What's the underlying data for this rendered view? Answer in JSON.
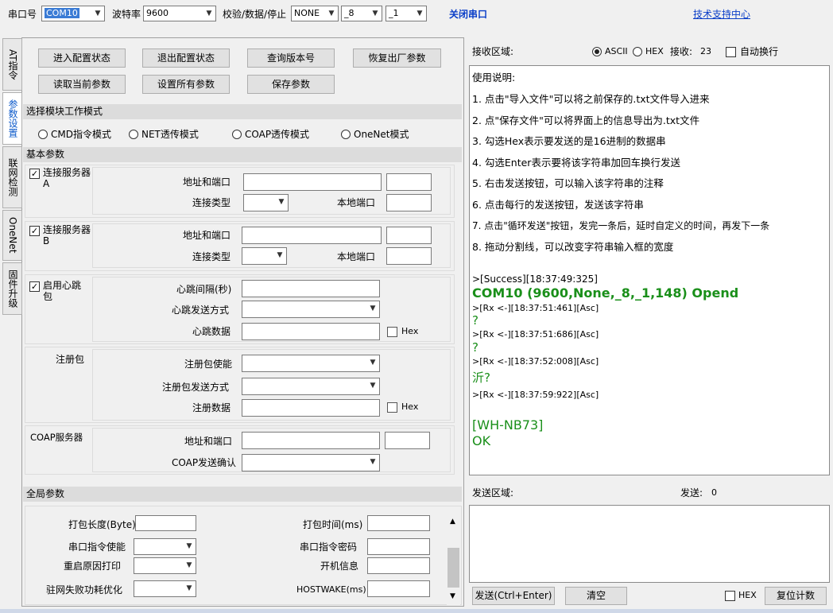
{
  "toolbar": {
    "port_label": "串口号",
    "port_value": "COM10",
    "baud_label": "波特率",
    "baud_value": "9600",
    "parity_label": "校验/数据/停止",
    "parity_value": "NONE",
    "databits_value": "_8",
    "stopbits_value": "_1",
    "close_port": "关闭串口",
    "support_link": "技术支持中心"
  },
  "tabs": [
    "AT指令",
    "参数设置",
    "联网检测",
    "OneNet",
    "固件升级"
  ],
  "config_buttons": {
    "enter_config": "进入配置状态",
    "exit_config": "退出配置状态",
    "query_version": "查询版本号",
    "factory_reset": "恢复出厂参数",
    "read_params": "读取当前参数",
    "set_params": "设置所有参数",
    "save_params": "保存参数"
  },
  "mode_section": {
    "title": "选择模块工作模式",
    "options": [
      "CMD指令模式",
      "NET透传模式",
      "COAP透传模式",
      "OneNet模式"
    ]
  },
  "basic_section": {
    "title": "基本参数",
    "server_a_label": "连接服务器A",
    "server_b_label": "连接服务器B",
    "addr_port": "地址和端口",
    "conn_type": "连接类型",
    "local_port": "本地端口",
    "heartbeat_label": "启用心跳包",
    "hb_interval": "心跳间隔(秒)",
    "hb_send_mode": "心跳发送方式",
    "hb_data": "心跳数据",
    "hex": "Hex",
    "reg_label": "注册包",
    "reg_enable": "注册包使能",
    "reg_send_mode": "注册包发送方式",
    "reg_data": "注册数据",
    "coap_label": "COAP服务器",
    "coap_addr": "地址和端口",
    "coap_confirm": "COAP发送确认"
  },
  "global_section": {
    "title": "全局参数",
    "pack_len": "打包长度(Byte)",
    "pack_time": "打包时间(ms)",
    "uart_cmd_enable": "串口指令使能",
    "uart_cmd_pwd": "串口指令密码",
    "reboot_reason": "重启原因打印",
    "boot_info": "开机信息",
    "net_fail_opt": "驻网失败功耗优化",
    "hostwake": "HOSTWAKE(ms)"
  },
  "receive": {
    "label": "接收区域:",
    "ascii": "ASCII",
    "hex": "HEX",
    "recv_count_label": "接收:",
    "recv_count": "23",
    "auto_wrap": "自动换行",
    "instructions_title": "使用说明:",
    "instructions": [
      "1. 点击\"导入文件\"可以将之前保存的.txt文件导入进来",
      "2. 点\"保存文件\"可以将界面上的信息导出为.txt文件",
      "3. 勾选Hex表示要发送的是16进制的数据串",
      "4. 勾选Enter表示要将该字符串加回车换行发送",
      "5. 右击发送按钮，可以输入该字符串的注释",
      "6. 点击每行的发送按钮，发送该字符串",
      "7. 点击\"循环发送\"按钮，发完一条后，延时自定义的时间，再发下一条",
      "8. 拖动分割线，可以改变字符串输入框的宽度"
    ],
    "log_success": ">[Success][18:37:49:325]",
    "log_opened": "COM10 (9600,None,_8,_1,148) Opend",
    "log_rx1": ">[Rx <-][18:37:51:461][Asc]",
    "log_q1": "?",
    "log_rx2": ">[Rx <-][18:37:51:686][Asc]",
    "log_q2": "?",
    "log_rx3": ">[Rx <-][18:37:52:008][Asc]",
    "log_q3": "沂?",
    "log_rx4": ">[Rx <-][18:37:59:922][Asc]",
    "log_model": "[WH-NB73]",
    "log_ok": "OK"
  },
  "send": {
    "label": "发送区域:",
    "sent_label": "发送:",
    "sent_count": "0",
    "send_button": "发送(Ctrl+Enter)",
    "clear_button": "清空",
    "hex": "HEX",
    "reset_count": "复位计数"
  },
  "colors": {
    "accent_blue": "#0a3ec8",
    "log_green": "#1a8f1a",
    "section_header": "#dcdcdc"
  }
}
